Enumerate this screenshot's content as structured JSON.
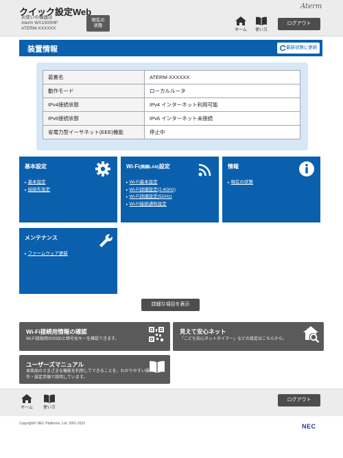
{
  "header": {
    "app_title": "クイック設定Web",
    "device_label": "お使いの機器は",
    "device_model": "Aterm WX1500HP",
    "device_name": "ATERM-XXXXXX",
    "status_button": "現在の状態",
    "brand": "Aterm",
    "home_label": "ホーム",
    "manual_label": "使い方",
    "logout_label": "ログアウト"
  },
  "section": {
    "title": "装置情報",
    "refresh_label": "最新状態に更新"
  },
  "device_table": [
    {
      "key": "装置名",
      "value": "ATERM-XXXXXX"
    },
    {
      "key": "動作モード",
      "value": "ローカルルータ"
    },
    {
      "key": "IPv4接続状態",
      "value": "IPv4 インターネット利用可能"
    },
    {
      "key": "IPv6接続状態",
      "value": "IPv6 インターネット未接続"
    },
    {
      "key": "省電力型イーサネット(EEE)機能",
      "value": "停止中"
    }
  ],
  "tiles": {
    "basic": {
      "title": "基本設定",
      "links": [
        "基本設定",
        "接続先設定"
      ]
    },
    "wifi": {
      "title_main": "Wi-Fi",
      "title_small": "(無線LAN)",
      "title_suffix": "設定",
      "links": [
        "Wi-Fi基本設定",
        "Wi-Fi詳細設定(2.4GHz)",
        "Wi-Fi詳細設定(5GHz)",
        "Wi-Fi接続通知設定"
      ]
    },
    "info": {
      "title": "情報",
      "links": [
        "現在の状態"
      ]
    },
    "maintenance": {
      "title": "メンテナンス",
      "links": [
        "ファームウェア更新"
      ]
    }
  },
  "detail_button": "詳細な項目を表示",
  "cards": {
    "wifi_info": {
      "title": "Wi-Fi接続用情報の確認",
      "desc": "Wi-Fi接続用のSSIDと暗号化キーを確認できます。"
    },
    "safety": {
      "title": "見えて安心ネット",
      "desc": "「こども安心ネットタイマー」などの設定はこちらから。"
    },
    "manual": {
      "title": "ユーザーズマニュアル",
      "desc_line1": "本商品のさまざまな機能を利用してできることを、わかりやすい操",
      "desc_line2": "作・設定手順で説明しています。"
    }
  },
  "footer": {
    "home_label": "ホーム",
    "manual_label": "使い方",
    "logout_label": "ログアウト",
    "copyright": "Copyright© NEC Platforms, Ltd. 2001-2022",
    "brand": "NEC"
  },
  "colors": {
    "primary_blue": "#0b60ae",
    "dark_gray": "#5a5a5a",
    "panel_blue": "#d7e7f6"
  },
  "icons": [
    "home-icon",
    "book-icon",
    "refresh-icon",
    "gear-icon",
    "wifi-icon",
    "info-icon",
    "wrench-icon",
    "qr-code-icon",
    "house-search-icon",
    "open-book-icon"
  ]
}
